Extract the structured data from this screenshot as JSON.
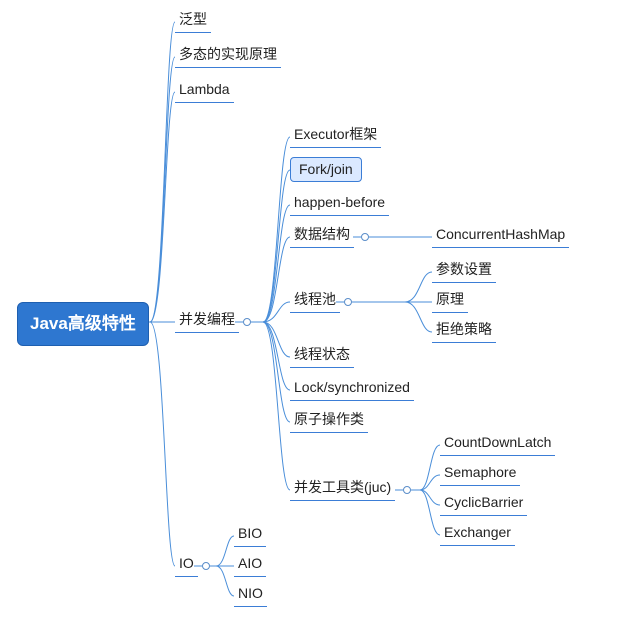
{
  "root": {
    "label": "Java高级特性"
  },
  "level1": {
    "generics": {
      "label": "泛型"
    },
    "polymorphism": {
      "label": "多态的实现原理"
    },
    "lambda": {
      "label": "Lambda"
    },
    "concurrency": {
      "label": "并发编程"
    },
    "io": {
      "label": "IO"
    }
  },
  "concurrency_children": {
    "executor": {
      "label": "Executor框架"
    },
    "forkjoin": {
      "label": "Fork/join"
    },
    "happenbefore": {
      "label": "happen-before"
    },
    "datastructure": {
      "label": "数据结构"
    },
    "threadpool": {
      "label": "线程池"
    },
    "threadstate": {
      "label": "线程状态"
    },
    "lock": {
      "label": "Lock/synchronized"
    },
    "atomic": {
      "label": "原子操作类"
    },
    "juc": {
      "label": "并发工具类(juc)"
    }
  },
  "datastructure_children": {
    "chm": {
      "label": "ConcurrentHashMap"
    }
  },
  "threadpool_children": {
    "params": {
      "label": "参数设置"
    },
    "principle": {
      "label": "原理"
    },
    "reject": {
      "label": "拒绝策略"
    }
  },
  "juc_children": {
    "cdl": {
      "label": "CountDownLatch"
    },
    "sem": {
      "label": "Semaphore"
    },
    "cb": {
      "label": "CyclicBarrier"
    },
    "ex": {
      "label": "Exchanger"
    }
  },
  "io_children": {
    "bio": {
      "label": "BIO"
    },
    "aio": {
      "label": "AIO"
    },
    "nio": {
      "label": "NIO"
    }
  }
}
